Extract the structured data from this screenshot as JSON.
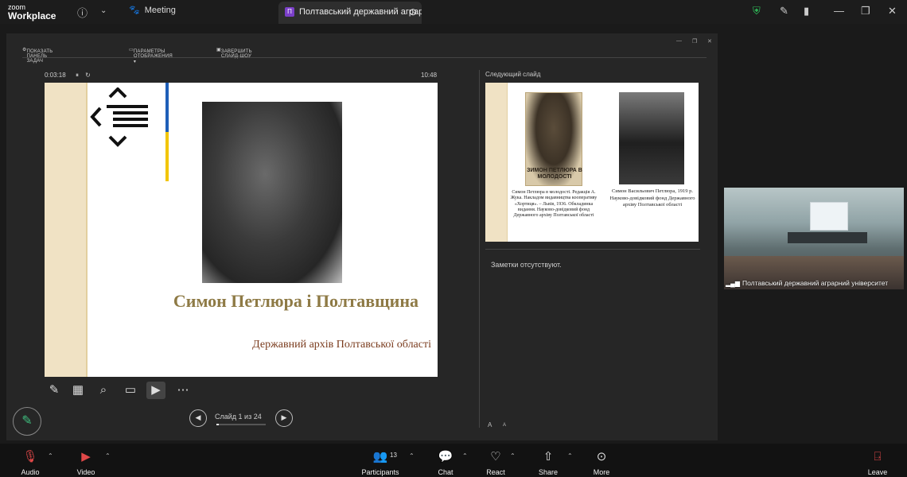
{
  "app": {
    "logo_line1": "zoom",
    "logo_line2": "Workplace"
  },
  "titlebar": {
    "tabs": [
      {
        "label": "Meeting"
      },
      {
        "badge": "П",
        "label": "Полтавський державний аграр"
      }
    ]
  },
  "presenter": {
    "toolbar": {
      "show_taskbar": "ПОКАЗАТЬ ПАНЕЛЬ ЗАДАЧ",
      "display_settings": "ПАРАМЕТРЫ ОТОБРАЖЕНИЯ ▾",
      "end_show": "ЗАВЕРШИТЬ СЛАЙД-ШОУ"
    },
    "timer": "0:03:18",
    "clock": "10:48",
    "slide": {
      "title": "Симон Петлюра і Полтавщина",
      "subtitle": "Державний архів Полтавської області"
    },
    "counter": "Слайд 1 из 24",
    "progress_fraction": 0.0417,
    "next_label": "Следующий слайд",
    "next_slide": {
      "photo1_caption_text": "ЗИМОН ПЕТЛЮРА В МОЛОДОСТІ",
      "caption1": "Симон Петлюра в молодості. Редакція А. Жука. Накладом видавництва кооперативу «Хортиця». – Львів, 1936. Обкладинка видання. Науково-довідковий фонд Державного архіву Полтавської області",
      "caption2": "Симон Васильович Петлюра, 1919 р. Науково-довідковий фонд Державного архіву Полтавської області"
    },
    "notes": "Заметки отсутствуют.",
    "font_increase": "A",
    "font_decrease": "A"
  },
  "video_tile": {
    "name": "Полтавський державний аграрний університет"
  },
  "bottom_bar": {
    "audio": "Audio",
    "video": "Video",
    "participants": "Participants",
    "participants_count": "13",
    "chat": "Chat",
    "react": "React",
    "share": "Share",
    "more": "More",
    "leave": "Leave"
  },
  "colors": {
    "accent_green": "#3fbf7f",
    "leave_red": "#e04848",
    "flag_blue": "#1f5fb8",
    "flag_yellow": "#f2c500"
  }
}
